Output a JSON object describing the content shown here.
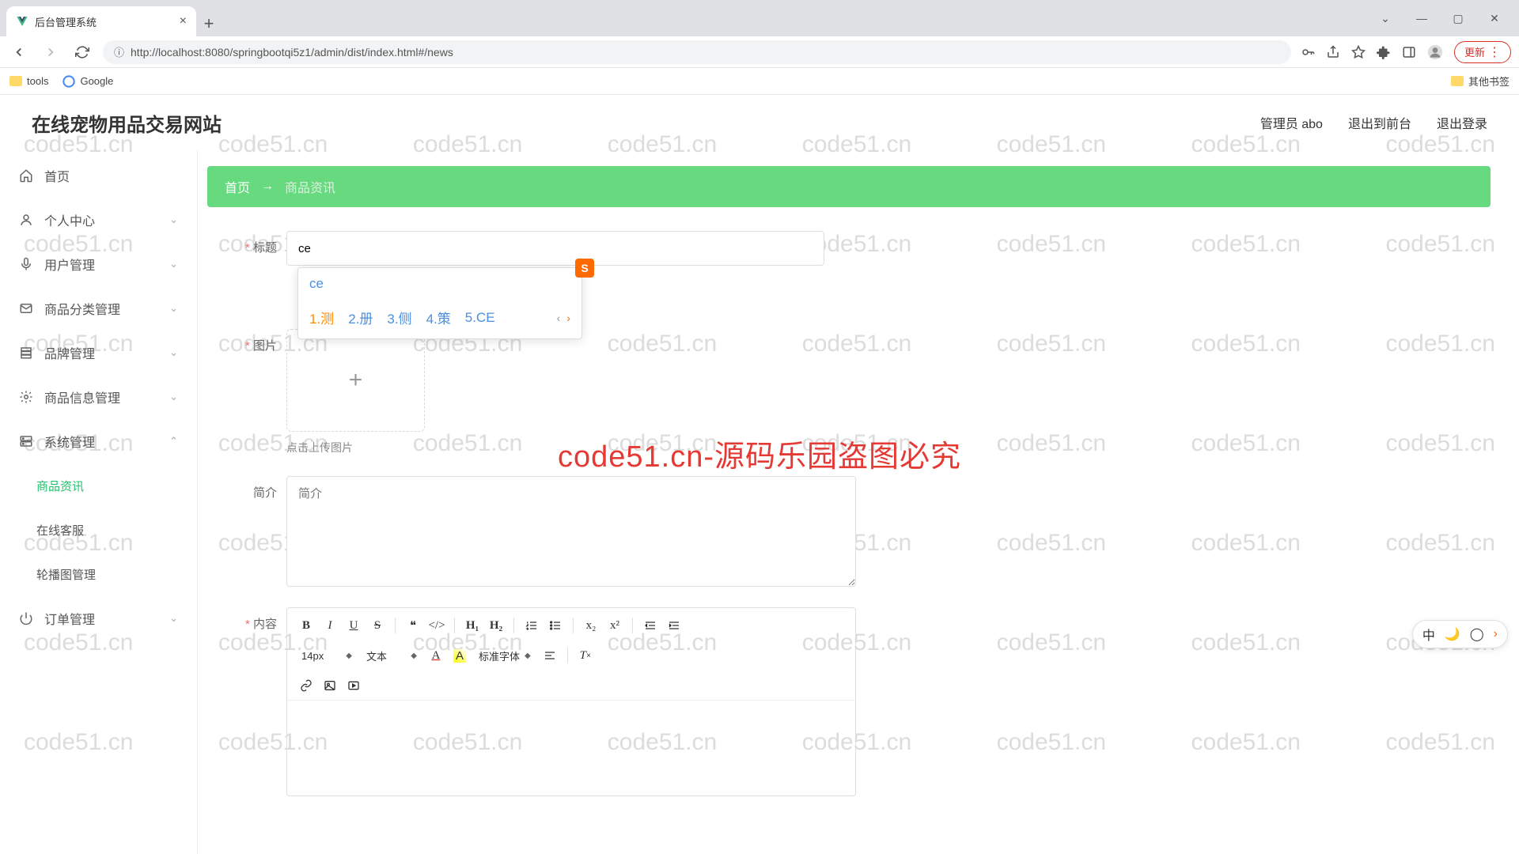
{
  "browser": {
    "tab_title": "后台管理系统",
    "url": "http://localhost:8080/springbootqi5z1/admin/dist/index.html#/news",
    "update_label": "更新",
    "bookmarks": {
      "tools": "tools",
      "google": "Google",
      "other": "其他书签"
    }
  },
  "app": {
    "title": "在线宠物用品交易网站",
    "header": {
      "admin": "管理员 abo",
      "frontend": "退出到前台",
      "logout": "退出登录"
    }
  },
  "sidebar": {
    "items": [
      {
        "label": "首页",
        "icon": "home"
      },
      {
        "label": "个人中心",
        "icon": "user",
        "expandable": true
      },
      {
        "label": "用户管理",
        "icon": "mic",
        "expandable": true
      },
      {
        "label": "商品分类管理",
        "icon": "mail",
        "expandable": true
      },
      {
        "label": "品牌管理",
        "icon": "stack",
        "expandable": true
      },
      {
        "label": "商品信息管理",
        "icon": "gear",
        "expandable": true
      },
      {
        "label": "系统管理",
        "icon": "server",
        "expandable": true,
        "expanded": true,
        "children": [
          {
            "label": "商品资讯",
            "active": true
          },
          {
            "label": "在线客服"
          },
          {
            "label": "轮播图管理"
          }
        ]
      },
      {
        "label": "订单管理",
        "icon": "power",
        "expandable": true
      }
    ]
  },
  "breadcrumb": {
    "home": "首页",
    "current": "商品资讯"
  },
  "form": {
    "title": {
      "label": "标题",
      "value": "ce"
    },
    "image": {
      "label": "图片",
      "hint": "点击上传图片"
    },
    "intro": {
      "label": "简介",
      "placeholder": "简介"
    },
    "content": {
      "label": "内容"
    }
  },
  "ime": {
    "input": "ce",
    "badge": "S",
    "candidates": [
      "1.测",
      "2.册",
      "3.侧",
      "4.策",
      "5.CE"
    ]
  },
  "editor": {
    "font_size": "14px",
    "style_label": "文本",
    "font_family": "标准字体"
  },
  "watermark": {
    "text": "code51.cn",
    "center": "code51.cn-源码乐园盗图必究"
  },
  "float": {
    "lang": "中"
  }
}
